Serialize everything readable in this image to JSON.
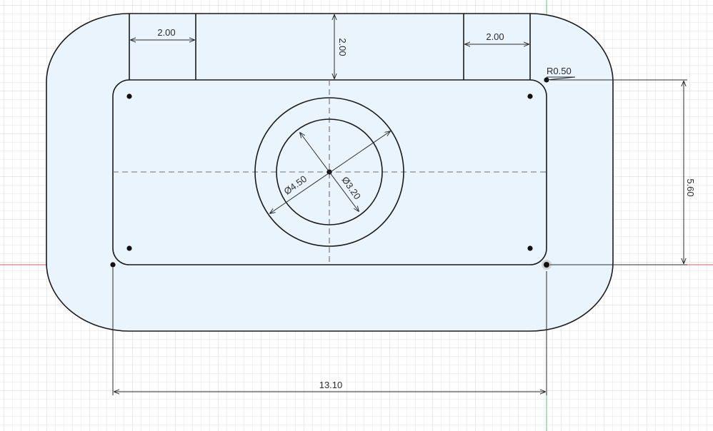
{
  "sketch": {
    "colors": {
      "background": "#ffffff",
      "grid_minor": "#e3e6ea",
      "grid_major": "#cfd4da",
      "profile_fill": "#e9f4fc",
      "geometry": "#1a1a1a",
      "dimension": "#2b2b2b",
      "construction": "#6f6f6f",
      "x_axis": "#e05a5a",
      "y_axis": "#58c76a"
    },
    "dimensions": {
      "slot_width_left": "2.00",
      "slot_width_right": "2.00",
      "slot_depth": "2.00",
      "corner_radius": "R0.50",
      "inner_height": "5.60",
      "overall_width": "13.10",
      "outer_circle_diameter": "Ø4.50",
      "inner_circle_diameter": "Ø3.20"
    }
  }
}
